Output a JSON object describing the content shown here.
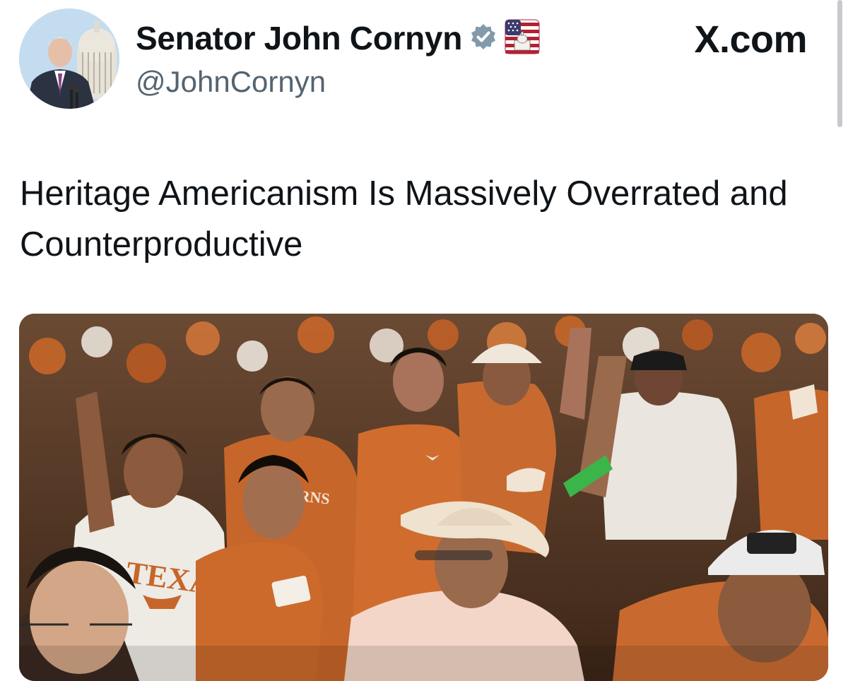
{
  "author": {
    "display_name": "Senator John Cornyn",
    "handle": "@JohnCornyn",
    "avatar_icon": "avatar-photo",
    "verified_badge_icon": "verified-badge-icon",
    "verified_badge_color": "#829aab",
    "flag_icon": "us-flag-capitol-icon"
  },
  "site": {
    "label": "X.com"
  },
  "post": {
    "text": "Heritage Americanism Is Massively Overrated and Counterproductive"
  },
  "media": {
    "shirt_texas": "TEXAS",
    "shirt_partial": "RNS"
  },
  "colors": {
    "burnt_orange": "#c6662a",
    "text_primary": "#0f1419",
    "text_secondary": "#536471"
  }
}
